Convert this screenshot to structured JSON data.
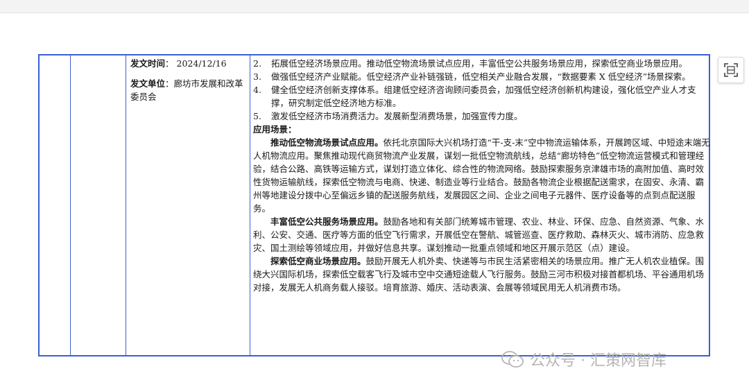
{
  "meta": {
    "date_label": "发文时间",
    "date_value": "2024/12/16",
    "unit_label": "发文单位",
    "unit_value": "廊坊市发展和改革委员会",
    "sep": "："
  },
  "items": [
    {
      "num": "2.",
      "text": "拓展低空经济场景应用。推动低空物流场景试点应用，丰富低空公共服务场景应用，探索低空商业场景应用。"
    },
    {
      "num": "3.",
      "text": "做强低空经济产业赋能。低空经济产业补链强链，低空相关产业融合发展，“数据要素 X 低空经济”场景探索。"
    },
    {
      "num": "4.",
      "text": "健全低空经济创新支撑体系。组建低空经济咨询顾问委员会，加强低空经济创新机构建设，强化低空产业人才支撑，研究制定低空经济地方标准。"
    },
    {
      "num": "5.",
      "text": "激发低空经济市场消费活力。发展新型消费场景，加强宣传力度。"
    }
  ],
  "section_heading": "应用场景：",
  "paragraphs": [
    {
      "lead": "推动低空物流场景试点应用。",
      "text": "依托北京国际大兴机场打造“干-支-末”空中物流运输体系，开展跨区域、中短途末端无人机物流应用。聚焦推动现代商贸物流产业发展，谋划一批低空物流航线，总结“廊坊特色”低空物流运营模式和管理经验，结合公路、高铁等运输方式，谋划打造立体化、综合性的物流网络。鼓励探索服务京津雄市场的高附加值、高时效性货物运输航线，探索低空物流与电商、快递、制造业等行业结合。鼓励各物流企业根据配送需求，在固安、永清、霸州等地建设分拨中心至偏远乡镇的配送服务航线，发展园区之间、企业之间电子元器件、医疗设备等的点到点配送服务。"
    },
    {
      "lead": "丰富低空公共服务场景应用。",
      "text": "鼓励各地和有关部门统筹城市管理、农业、林业、环保、应急、自然资源、气象、水利、公安、交通、医疗等方面的低空飞行需求，开展低空在警航、城管巡查、医疗救助、森林灭火、城市消防、应急救灾、国土测绘等领域应用，并做好信息共享。谋划推动一批重点领域和地区开展示范区（点）建设。"
    },
    {
      "lead": "探索低空商业场景应用。",
      "text": "鼓励开展无人机外卖、快递等与市民生活紧密相关的场景应用。推广无人机农业植保。围绕大兴国际机场，探索低空载客飞行及城市空中交通短途载人飞行服务。鼓励三河市积极对接首都机场、平谷通用机场对接，发展无人机商务载人接驳。培育旅游、婚庆、活动表演、会展等领域民用无人机消费市场。"
    }
  ],
  "watermark": "公众号 · 汇策网智库",
  "side_icon": "scan-icon"
}
